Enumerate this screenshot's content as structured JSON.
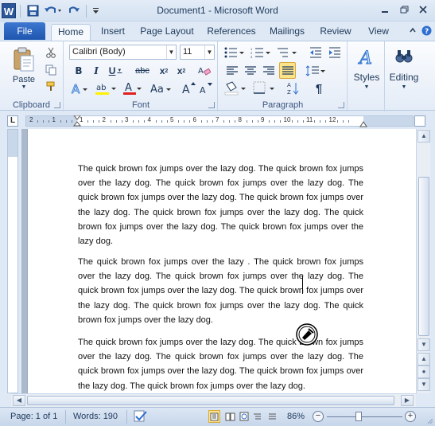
{
  "window": {
    "title": "Document1 - Microsoft Word",
    "logo": "W"
  },
  "ribbon_tabs": {
    "file": "File",
    "home": "Home",
    "insert": "Insert",
    "page_layout": "Page Layout",
    "references": "References",
    "mailings": "Mailings",
    "review": "Review",
    "view": "View"
  },
  "clipboard": {
    "paste_label": "Paste",
    "group_label": "Clipboard"
  },
  "font": {
    "font_name": "Calibri (Body)",
    "font_size": "11",
    "group_label": "Font"
  },
  "paragraph": {
    "group_label": "Paragraph"
  },
  "styles": {
    "label": "Styles"
  },
  "editing": {
    "label": "Editing"
  },
  "ruler": {
    "numbers": [
      "2",
      "1",
      "1",
      "2",
      "3",
      "4",
      "5",
      "6",
      "7",
      "8",
      "9",
      "10",
      "11",
      "12"
    ]
  },
  "document": {
    "paragraphs": [
      "The quick brown fox jumps over the lazy dog. The quick brown fox jumps over the lazy dog. The quick brown fox jumps over the lazy dog. The quick brown fox jumps over the lazy dog. The quick brown fox jumps over the lazy dog. The quick brown fox jumps over the lazy dog. The quick brown fox jumps over the lazy dog. The quick brown fox jumps over the lazy dog.",
      "The quick brown fox jumps over the lazy . The quick brown fox jumps over the lazy dog. The quick brown fox jumps over the lazy dog. The quick brown fox jumps over the lazy dog. The quick brown fox jumps over the lazy dog. The quick brown fox jumps over the lazy dog. The quick brown fox jumps over the lazy dog.",
      "The quick brown fox jumps over the lazy dog. The quick brown fox jumps over the lazy dog. The quick brown fox jumps over the lazy dog. The quick brown fox jumps over the lazy dog. The quick brown fox jumps over the lazy dog. The quick brown fox jumps over the lazy dog."
    ]
  },
  "statusbar": {
    "page": "Page: 1 of 1",
    "words": "Words: 190",
    "zoom": "86%",
    "zoom_minus": "−",
    "zoom_plus": "+",
    "zoom_level_fraction": 0.43
  },
  "colors": {
    "accent": "#2b579a",
    "file_tab": "#2a62c0",
    "highlight": "#fde48a"
  }
}
